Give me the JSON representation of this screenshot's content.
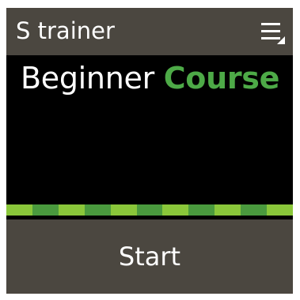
{
  "header": {
    "title": "S trainer",
    "menu_icon": "menu-icon"
  },
  "main": {
    "course_level": "Beginner",
    "course_word": "Course"
  },
  "progress": {
    "segments": 11
  },
  "actions": {
    "start_label": "Start"
  },
  "colors": {
    "header_bg": "#4b4740",
    "accent_green": "#4daa47",
    "progress_light": "#8ac73a",
    "progress_dark": "#4a9a3e"
  }
}
